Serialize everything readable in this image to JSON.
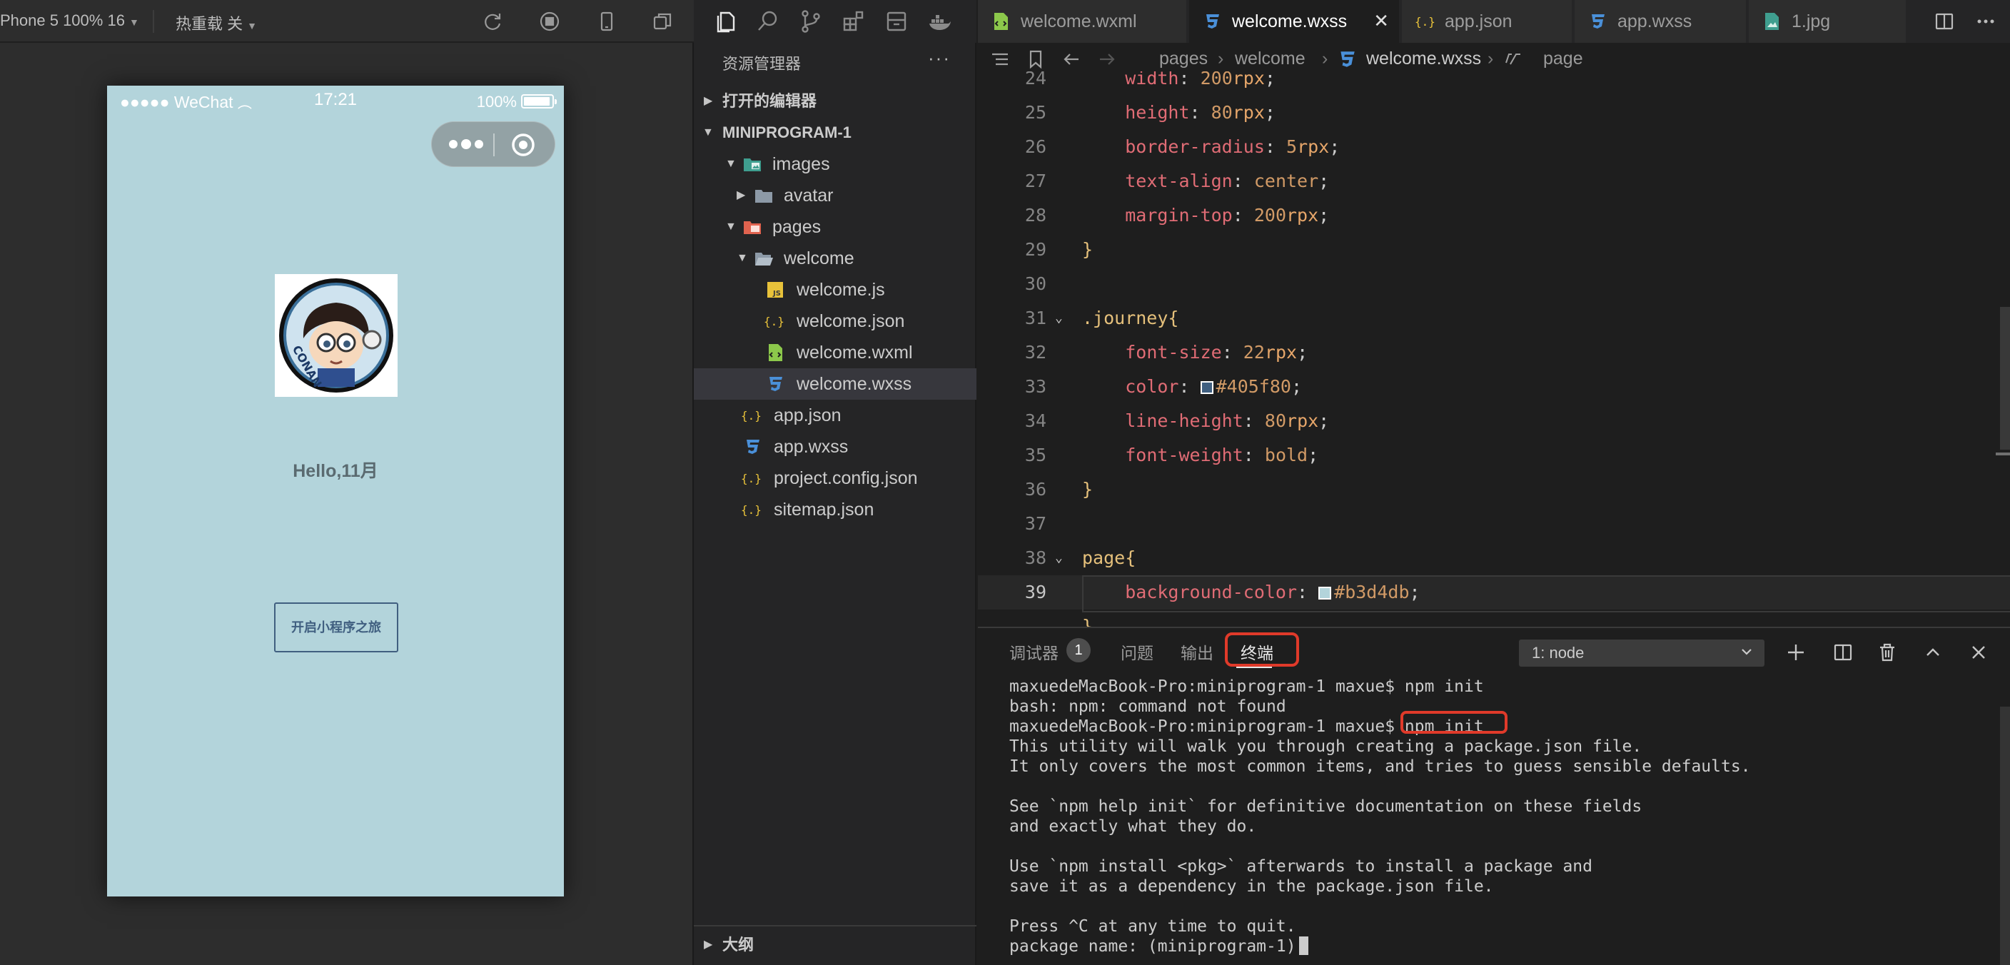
{
  "simulator": {
    "device": "Phone 5 100% 16",
    "hotreload": "热重载 关"
  },
  "phone": {
    "signal": "●●●●● WeChat",
    "time": "17:21",
    "battery": "100%",
    "hello": "Hello,11月",
    "button": "开启小程序之旅",
    "background": "#b3d4db"
  },
  "explorer": {
    "title": "资源管理器",
    "more": "···",
    "open_editors": "打开的编辑器",
    "project": "MINIPROGRAM-1",
    "tree": {
      "images": "images",
      "avatar": "avatar",
      "pages": "pages",
      "welcome": "welcome",
      "welcome_js": "welcome.js",
      "welcome_json": "welcome.json",
      "welcome_wxml": "welcome.wxml",
      "welcome_wxss": "welcome.wxss",
      "app_json": "app.json",
      "app_wxss": "app.wxss",
      "project_config": "project.config.json",
      "sitemap": "sitemap.json"
    },
    "outline": "大纲"
  },
  "tabs": [
    {
      "label": "welcome.wxml"
    },
    {
      "label": "welcome.wxss"
    },
    {
      "label": "app.json"
    },
    {
      "label": "app.wxss"
    },
    {
      "label": "1.jpg"
    }
  ],
  "breadcrumb": {
    "pages": "pages",
    "welcome": "welcome",
    "file": "welcome.wxss",
    "symbol": "page"
  },
  "code": {
    "lines": [
      {
        "n": "24",
        "p": "width",
        "v": "200",
        "u": "rpx"
      },
      {
        "n": "25",
        "p": "height",
        "v": "80",
        "u": "rpx"
      },
      {
        "n": "26",
        "p": "border-radius",
        "v": "5",
        "u": "rpx"
      },
      {
        "n": "27",
        "p": "text-align",
        "v": "center",
        "u": ""
      },
      {
        "n": "28",
        "p": "margin-top",
        "v": "200",
        "u": "rpx"
      },
      {
        "n": "29"
      },
      {
        "n": "30"
      },
      {
        "n": "31",
        "sel": ".journey"
      },
      {
        "n": "32",
        "p": "font-size",
        "v": "22",
        "u": "rpx"
      },
      {
        "n": "33",
        "p": "color",
        "c": "#405f80"
      },
      {
        "n": "34",
        "p": "line-height",
        "v": "80",
        "u": "rpx"
      },
      {
        "n": "35",
        "p": "font-weight",
        "v": "bold",
        "u": ""
      },
      {
        "n": "36"
      },
      {
        "n": "37"
      },
      {
        "n": "38",
        "sel": "page"
      },
      {
        "n": "39",
        "p": "background-color",
        "c": "#b3d4db"
      }
    ]
  },
  "panel": {
    "tab_debug": "调试器",
    "badge": "1",
    "tab_problems": "问题",
    "tab_output": "输出",
    "tab_terminal": "终端",
    "terminal_select": "1: node"
  },
  "terminal": {
    "l1": "maxuedeMacBook-Pro:miniprogram-1 maxue$ npm init",
    "l2": "bash: npm: command not found",
    "l3": "maxuedeMacBook-Pro:miniprogram-1 maxue$ npm init",
    "l4": "This utility will walk you through creating a package.json file.",
    "l5": "It only covers the most common items, and tries to guess sensible defaults.",
    "l6": "",
    "l7": "See `npm help init` for definitive documentation on these fields",
    "l8": "and exactly what they do.",
    "l9": "",
    "l10": "Use `npm install <pkg>` afterwards to install a package and",
    "l11": "save it as a dependency in the package.json file.",
    "l12": "",
    "l13": "Press ^C at any time to quit.",
    "l14": "package name: (miniprogram-1)"
  }
}
